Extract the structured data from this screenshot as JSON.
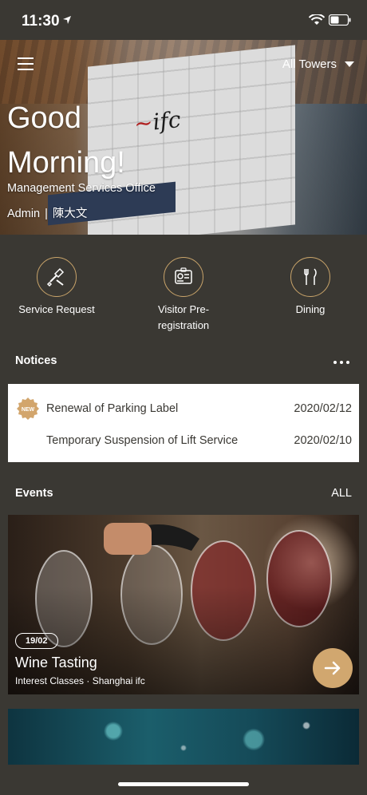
{
  "status_bar": {
    "time": "11:30"
  },
  "hero": {
    "tower_selector": "All Towers",
    "greeting": "Good Morning!",
    "office": "Management Services Office",
    "role": "Admin",
    "user_name": "陳大文",
    "logo_text": "ifc"
  },
  "quick_actions": [
    {
      "label": "Service Request",
      "icon": "tools-icon"
    },
    {
      "label": "Visitor Pre-registration",
      "icon": "visitor-card-icon"
    },
    {
      "label": "Dining",
      "icon": "fork-knife-icon"
    }
  ],
  "notices": {
    "title": "Notices",
    "items": [
      {
        "title": "Renewal of Parking Label",
        "date": "2020/02/12",
        "badge": "NEW"
      },
      {
        "title": "Temporary Suspension of Lift Service",
        "date": "2020/02/10",
        "badge": ""
      }
    ]
  },
  "events": {
    "title": "Events",
    "all_label": "ALL",
    "items": [
      {
        "date": "19/02",
        "title": "Wine Tasting",
        "meta": "Interest Classes · Shanghai ifc"
      }
    ]
  },
  "colors": {
    "background": "#3a3833",
    "accent": "#c9a46a",
    "go_button": "#d1a76f"
  }
}
